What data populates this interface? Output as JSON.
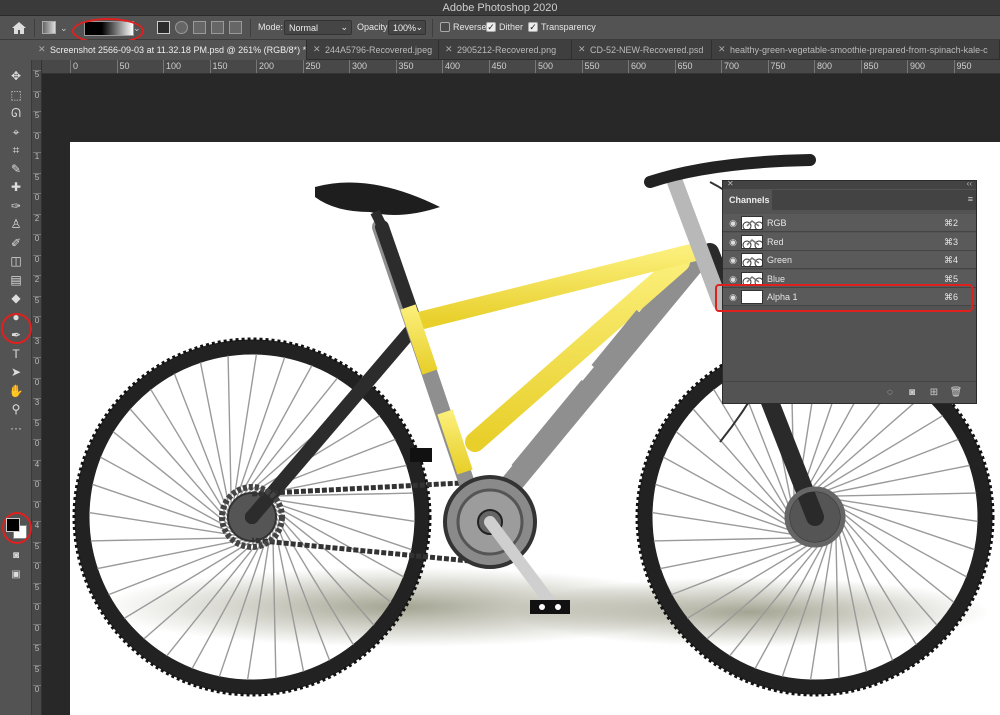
{
  "app": {
    "title": "Adobe Photoshop 2020"
  },
  "options": {
    "mode_label": "Mode:",
    "mode_value": "Normal",
    "opacity_label": "Opacity:",
    "opacity_value": "100%",
    "reverse_label": "Reverse",
    "dither_label": "Dither",
    "transparency_label": "Transparency",
    "reverse_checked": false,
    "dither_checked": true,
    "transparency_checked": true
  },
  "tabs": [
    {
      "label": "Screenshot 2566-09-03 at 11.32.18 PM.psd @ 261% (RGB/8*) *",
      "active": true
    },
    {
      "label": "244A5796-Recovered.jpeg",
      "active": false
    },
    {
      "label": "2905212-Recovered.png",
      "active": false
    },
    {
      "label": "CD-52-NEW-Recovered.psd",
      "active": false
    },
    {
      "label": "healthy-green-vegetable-smoothie-prepared-from-spinach-kale-c",
      "active": false
    }
  ],
  "ruler_h": [
    "0",
    "50",
    "100",
    "150",
    "200",
    "250",
    "300",
    "350",
    "400",
    "450",
    "500",
    "550",
    "600",
    "650",
    "700",
    "750",
    "800",
    "850",
    "900",
    "950"
  ],
  "ruler_v": [
    "5",
    "0",
    "5",
    "0",
    "1",
    "5",
    "0",
    "2",
    "0",
    "0",
    "2",
    "5",
    "0",
    "3",
    "0",
    "0",
    "3",
    "5",
    "0",
    "4",
    "0",
    "0",
    "4",
    "5",
    "0",
    "5",
    "0",
    "0",
    "5",
    "5",
    "0"
  ],
  "toolbar": {
    "icons": [
      "move-icon",
      "marquee-icon",
      "lasso-icon",
      "quick-select-icon",
      "crop-icon",
      "eyedropper-icon",
      "healing-icon",
      "brush-icon",
      "clone-stamp-icon",
      "history-brush-icon",
      "eraser-icon",
      "gradient-icon",
      "blur-icon",
      "dodge-icon",
      "pen-icon",
      "type-icon",
      "path-select-icon",
      "hand-icon",
      "zoom-icon",
      "more-icon"
    ],
    "glyphs": [
      "✥",
      "⬚",
      "ᘏ",
      "⌖",
      "⌗",
      "✎",
      "✚",
      "✑",
      "♙",
      "✐",
      "◫",
      "▤",
      "◆",
      "●",
      "✒",
      "T",
      "➤",
      "✋",
      "⚲",
      "···"
    ]
  },
  "channels_panel": {
    "title": "Channels",
    "rows": [
      {
        "name": "RGB",
        "shortcut": "⌘2"
      },
      {
        "name": "Red",
        "shortcut": "⌘3"
      },
      {
        "name": "Green",
        "shortcut": "⌘4"
      },
      {
        "name": "Blue",
        "shortcut": "⌘5"
      },
      {
        "name": "Alpha 1",
        "shortcut": "⌘6"
      }
    ]
  },
  "colors": {
    "accent_red": "#e0201e",
    "frame_yellow": "#f3df4a",
    "frame_gray": "#8f8f8f",
    "tire": "#222222"
  }
}
